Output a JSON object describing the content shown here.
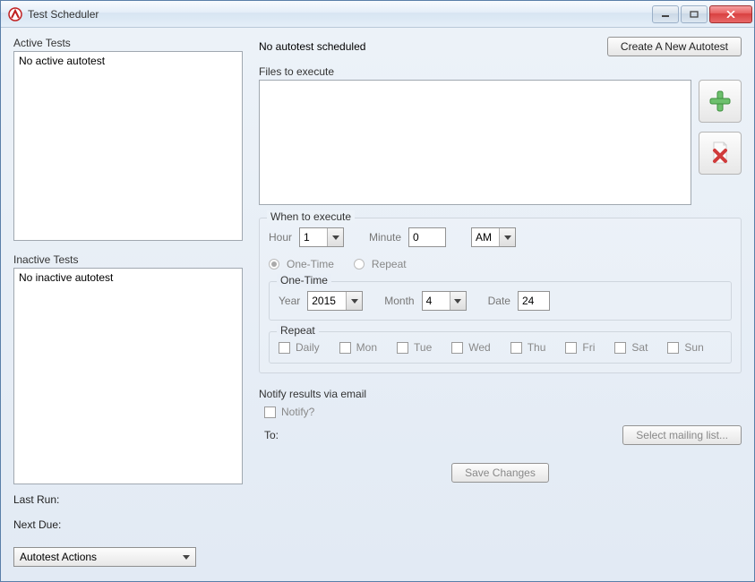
{
  "window": {
    "title": "Test Scheduler"
  },
  "left": {
    "active_label": "Active Tests",
    "active_placeholder": "No active autotest",
    "inactive_label": "Inactive Tests",
    "inactive_placeholder": "No inactive autotest",
    "last_run_label": "Last Run:",
    "next_due_label": "Next Due:",
    "actions_label": "Autotest Actions"
  },
  "right": {
    "status_text": "No autotest scheduled",
    "create_button": "Create A New Autotest",
    "files_label": "Files to execute"
  },
  "when": {
    "legend": "When to execute",
    "hour_label": "Hour",
    "hour_value": "1",
    "minute_label": "Minute",
    "minute_value": "0",
    "ampm_value": "AM",
    "one_time_radio": "One-Time",
    "repeat_radio": "Repeat",
    "one_time_legend": "One-Time",
    "year_label": "Year",
    "year_value": "2015",
    "month_label": "Month",
    "month_value": "4",
    "date_label": "Date",
    "date_value": "24",
    "repeat_legend": "Repeat",
    "daily": "Daily",
    "mon": "Mon",
    "tue": "Tue",
    "wed": "Wed",
    "thu": "Thu",
    "fri": "Fri",
    "sat": "Sat",
    "sun": "Sun"
  },
  "notify": {
    "header": "Notify results via email",
    "notify_label": "Notify?",
    "to_label": "To:",
    "select_mailing": "Select mailing list..."
  },
  "save": {
    "label": "Save Changes"
  }
}
